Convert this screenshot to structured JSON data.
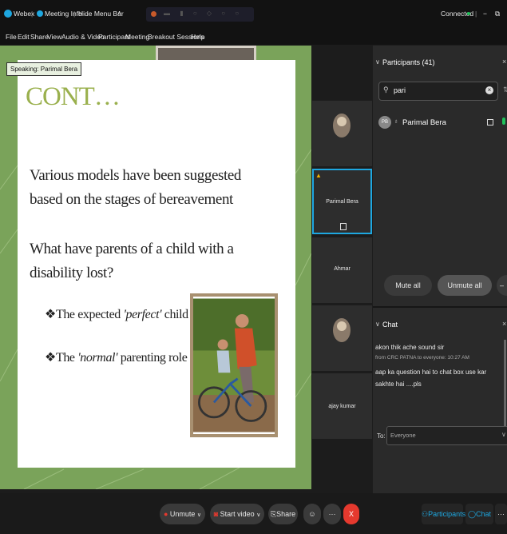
{
  "titlebar": {
    "app": "Webex",
    "sep1": "|",
    "meeting_info": "Meeting Info",
    "sep2": "|",
    "hide_menu": "Hide Menu Bar",
    "connected": "Connected",
    "sep3": "|",
    "min": "−",
    "restore": "⧉"
  },
  "menu": [
    "File",
    "Edit",
    "Share",
    "View",
    "Audio & Video",
    "Participant",
    "Meeting",
    "Breakout Sessions",
    "Help"
  ],
  "speaking": "Speaking: Parimal Bera",
  "slide": {
    "title": "CONT…",
    "para1": "Various models have been suggested based on the stages of bereavement",
    "para2": "What have parents of a child with a disability lost?",
    "bullet1_pre": "The expected ",
    "bullet1_em": "'perfect'",
    "bullet1_post": " child",
    "bullet2_pre": "The ",
    "bullet2_em": "'normal'",
    "bullet2_post": " parenting role"
  },
  "tiles": [
    {
      "name": ""
    },
    {
      "name": "Parimal Bera"
    },
    {
      "name": "Ahmar"
    },
    {
      "name": ""
    },
    {
      "name": "ajay kumar"
    }
  ],
  "participants": {
    "header": "Participants (41)",
    "search_value": "pari",
    "item_initials": "PB",
    "item_name": "Parimal Bera",
    "mute_all": "Mute all",
    "unmute_all": "Unmute all"
  },
  "chat": {
    "header": "Chat",
    "msg1": "akon thik ache sound sir",
    "meta": "from CRC PATNA to everyone:   10:27 AM",
    "msg2": "aap ka question hai to  chat box use kar sakhte hai ....pls",
    "to_label": "To:",
    "to_value": "Everyone"
  },
  "bottom": {
    "unmute": "Unmute",
    "start_video": "Start video",
    "share": "Share",
    "more": "···",
    "leave": "X",
    "participants": "Participants",
    "chat": "Chat",
    "overflow": "···"
  },
  "colors": {
    "accent": "#1ea7e0",
    "leave": "#e5392e",
    "connected": "#1fbf5a"
  }
}
